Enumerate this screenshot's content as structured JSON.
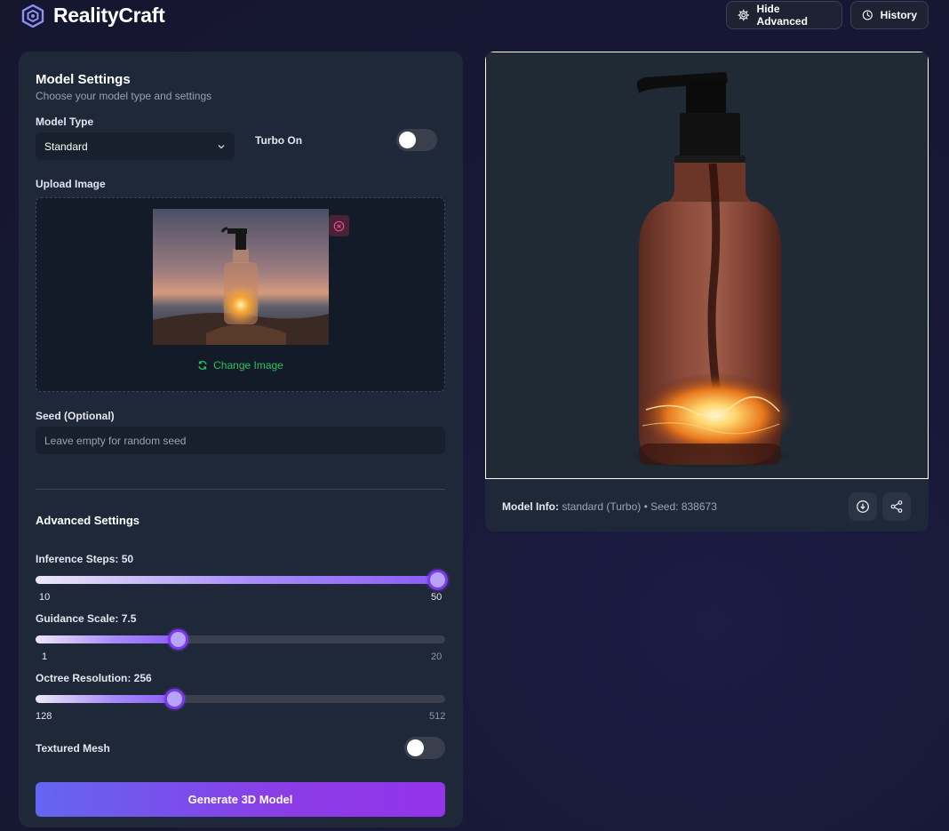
{
  "app": {
    "name": "RealityCraft",
    "header_buttons": {
      "advanced": "Hide Advanced",
      "history": "History"
    }
  },
  "settings": {
    "title": "Model Settings",
    "subtitle": "Choose your model type and settings",
    "model_type_label": "Model Type",
    "model_type_value": "Standard",
    "turbo_label": "Turbo On",
    "turbo_on": false,
    "upload_label": "Upload Image",
    "change_image": "Change Image",
    "seed_label": "Seed (Optional)",
    "seed_placeholder": "Leave empty for random seed",
    "seed_value": ""
  },
  "advanced": {
    "title": "Advanced Settings",
    "inference": {
      "label": "Inference Steps: 50",
      "value": 50,
      "min": "10",
      "max": "50"
    },
    "guidance": {
      "label": "Guidance Scale: 7.5",
      "value": 7.5,
      "min": "1",
      "max": "20"
    },
    "octree": {
      "label": "Octree Resolution: 256",
      "value": 256,
      "min": "128",
      "max": "512"
    },
    "textured_label": "Textured Mesh",
    "textured_on": false
  },
  "generate_label": "Generate 3D Model",
  "result": {
    "info_label": "Model Info:",
    "info_value": "standard (Turbo) • Seed: 838673"
  },
  "colors": {
    "accent": "#8b5cf6",
    "success": "#22c55e",
    "panel": "#1f2838"
  }
}
